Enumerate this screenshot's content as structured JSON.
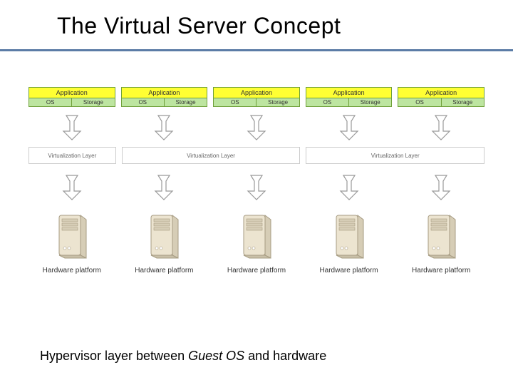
{
  "title": "The Virtual Server Concept",
  "app": {
    "header": "Application",
    "cell_os": "OS",
    "cell_storage": "Storage"
  },
  "virt_label": "Virtualization Layer",
  "hw_label": "Hardware platform",
  "caption_prefix": "Hypervisor layer between ",
  "caption_italic": "Guest OS",
  "caption_suffix": " and hardware",
  "colors": {
    "rule": "#5b7ca6",
    "app_header_bg": "#ffff33",
    "app_cell_bg": "#bde5a0"
  }
}
